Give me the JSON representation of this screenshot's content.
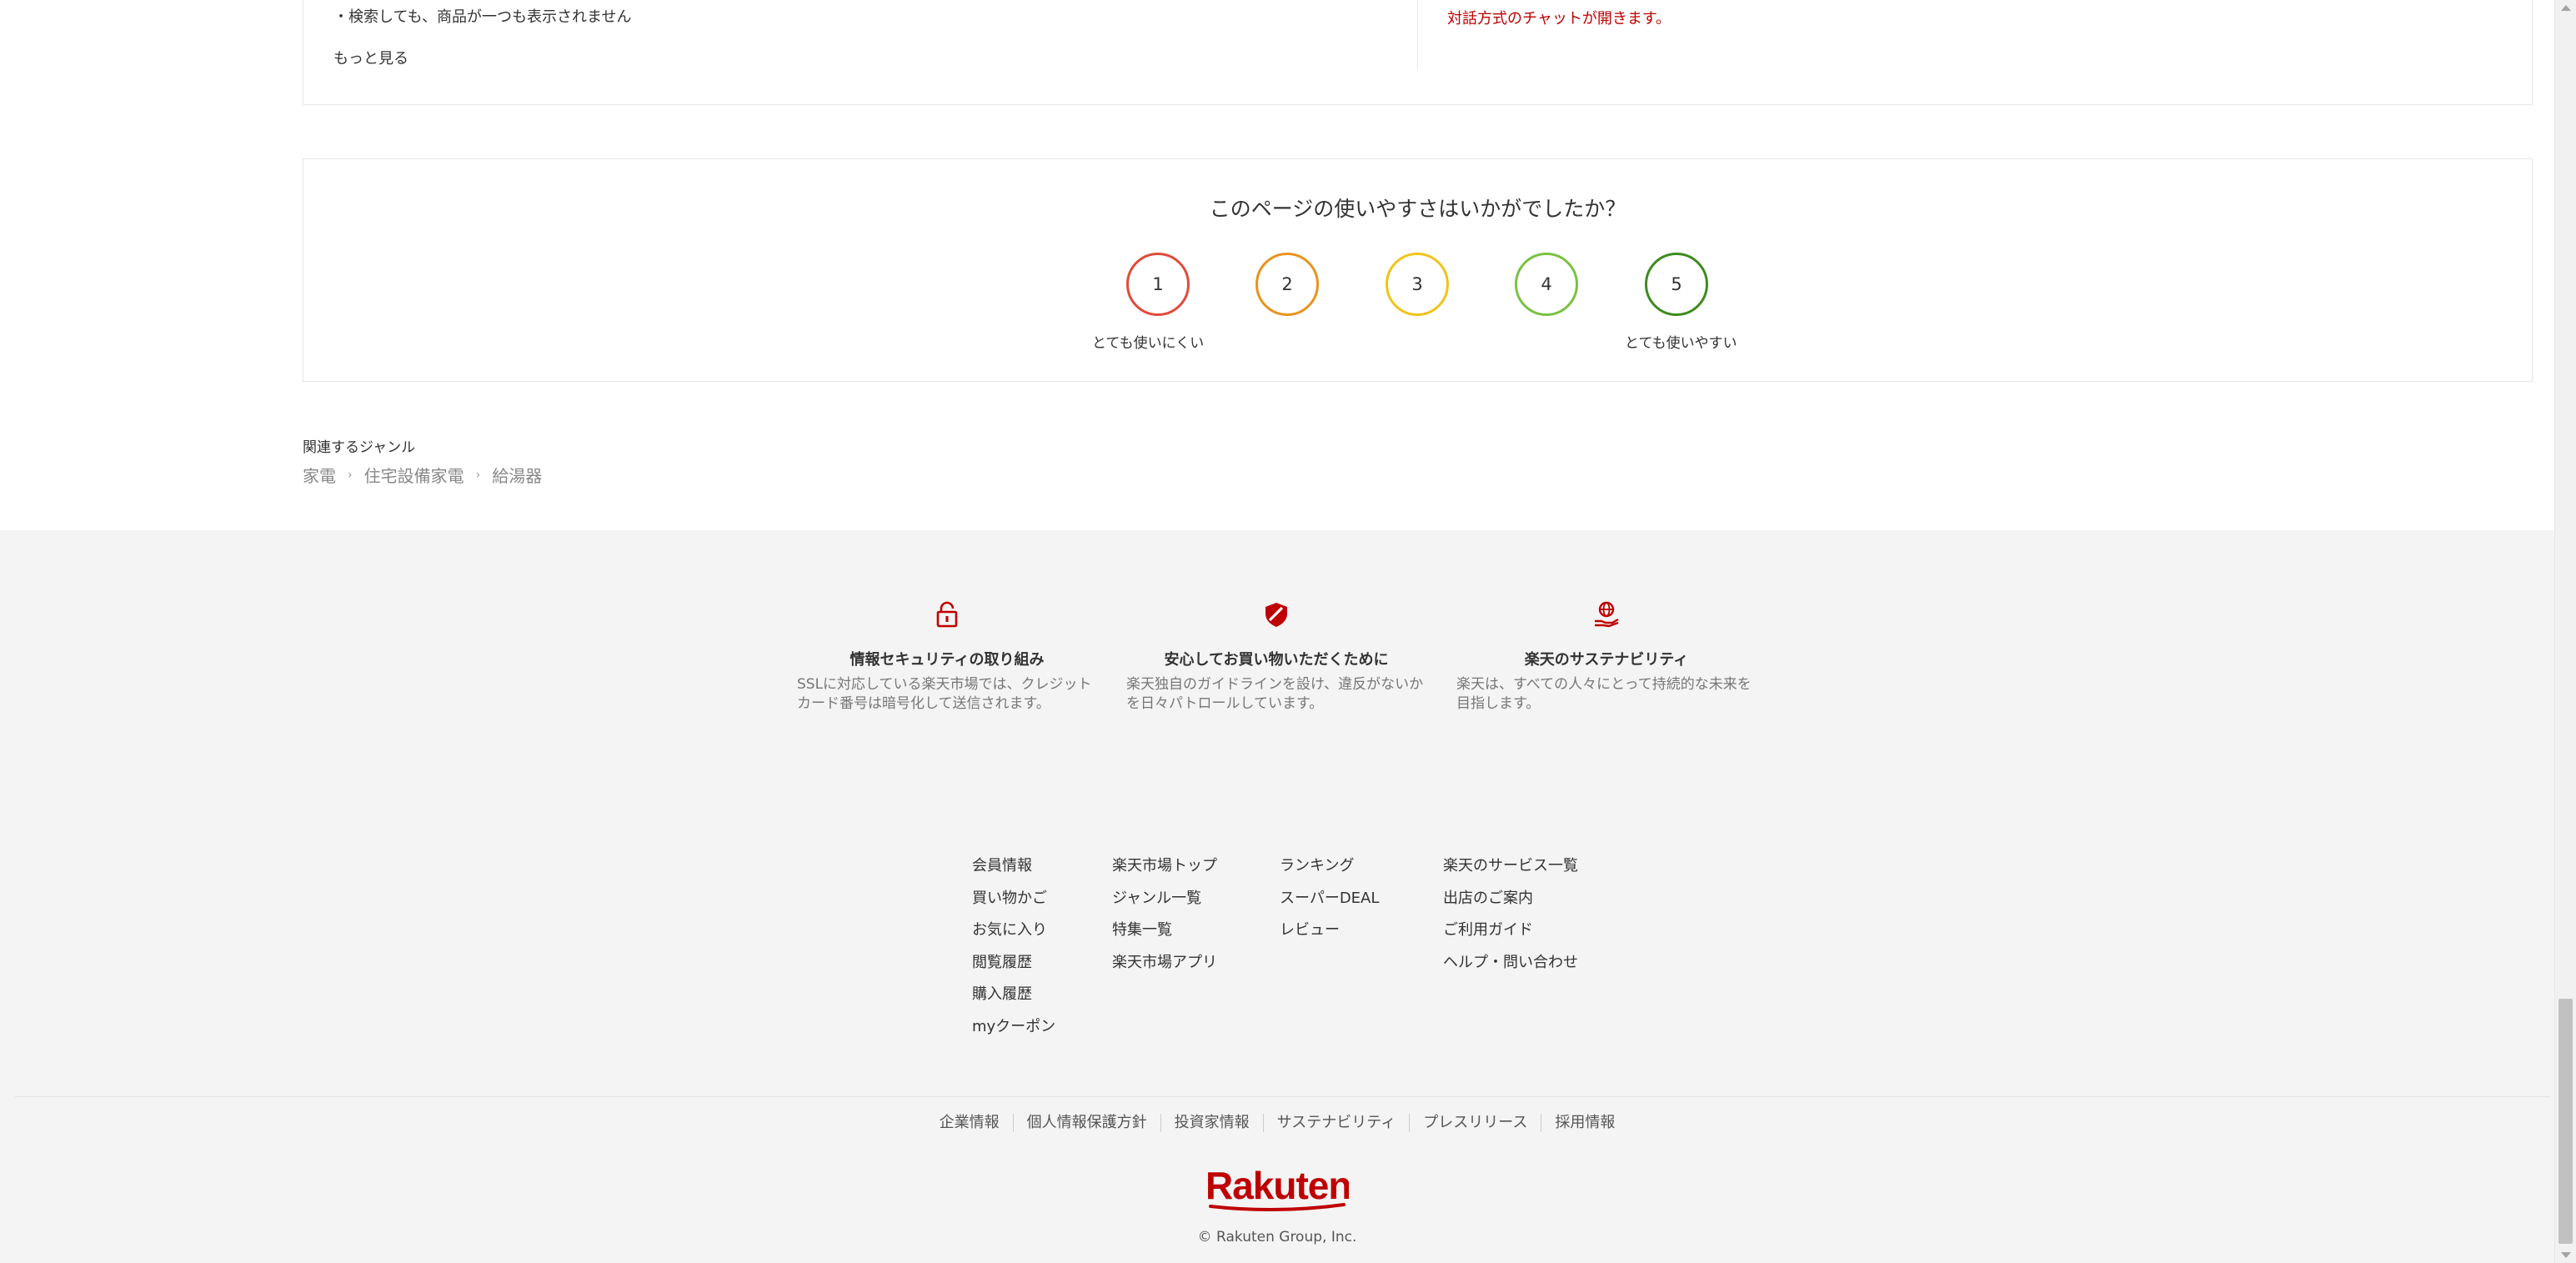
{
  "help": {
    "bullet": "・検索しても、商品が一つも表示されません",
    "more": "もっと見る",
    "chat_note": "対話方式のチャットが開きます。"
  },
  "survey": {
    "question": "このページの使いやすさはいかがでしたか？",
    "ratings": [
      {
        "label": "1",
        "color": "#e04b3a"
      },
      {
        "label": "2",
        "color": "#e8931e"
      },
      {
        "label": "3",
        "color": "#f0c419"
      },
      {
        "label": "4",
        "color": "#7ac143"
      },
      {
        "label": "5",
        "color": "#3d8b1f"
      }
    ],
    "low_label": "とても使いにくい",
    "high_label": "とても使いやすい"
  },
  "genre": {
    "title": "関連するジャンル",
    "crumbs": [
      "家電",
      "住宅設備家電",
      "給湯器"
    ],
    "separator": "›"
  },
  "assurance": [
    {
      "icon": "lock-icon",
      "title": "情報セキュリティの取り組み",
      "desc": "SSLに対応している楽天市場では、クレジットカード番号は暗号化して送信されます。"
    },
    {
      "icon": "shield-icon",
      "title": "安心してお買い物いただくために",
      "desc": "楽天独自のガイドラインを設け、違反がないかを日々パトロールしています。"
    },
    {
      "icon": "globe-hand-icon",
      "title": "楽天のサステナビリティ",
      "desc": "楽天は、すべての人々にとって持続的な未来を目指します。"
    }
  ],
  "footer_links": {
    "col1": [
      "会員情報",
      "買い物かご",
      "お気に入り",
      "閲覧履歴",
      "購入履歴",
      "myクーポン"
    ],
    "col2": [
      "楽天市場トップ",
      "ジャンル一覧",
      "特集一覧",
      "楽天市場アプリ"
    ],
    "col3": [
      "ランキング",
      "スーパーDEAL",
      "レビュー"
    ],
    "col4": [
      "楽天のサービス一覧",
      "出店のご案内",
      "ご利用ガイド",
      "ヘルプ・問い合わせ"
    ]
  },
  "corporate_links": [
    "企業情報",
    "個人情報保護方針",
    "投資家情報",
    "サステナビリティ",
    "プレスリリース",
    "採用情報"
  ],
  "brand": {
    "logo_text": "Rakuten",
    "accent": "#bf0000"
  },
  "copyright": "© Rakuten Group, Inc."
}
